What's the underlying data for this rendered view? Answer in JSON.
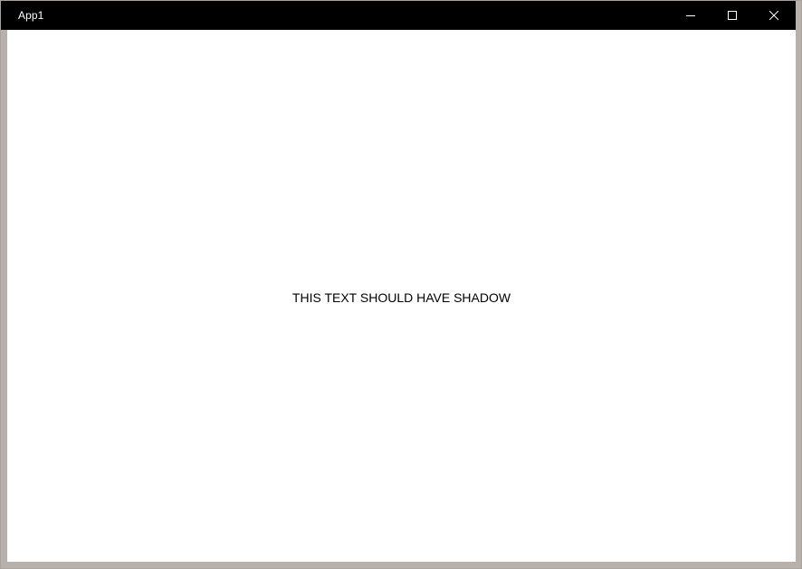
{
  "window": {
    "title": "App1"
  },
  "caption_buttons": {
    "minimize_icon": "minimize-icon",
    "maximize_icon": "maximize-icon",
    "close_icon": "close-icon"
  },
  "content": {
    "text": "THIS TEXT SHOULD HAVE SHADOW"
  },
  "colors": {
    "titlebar": "#000000",
    "title_text": "#ffffff",
    "content_background": "#ffffff",
    "frame": "#b8b0aa"
  }
}
